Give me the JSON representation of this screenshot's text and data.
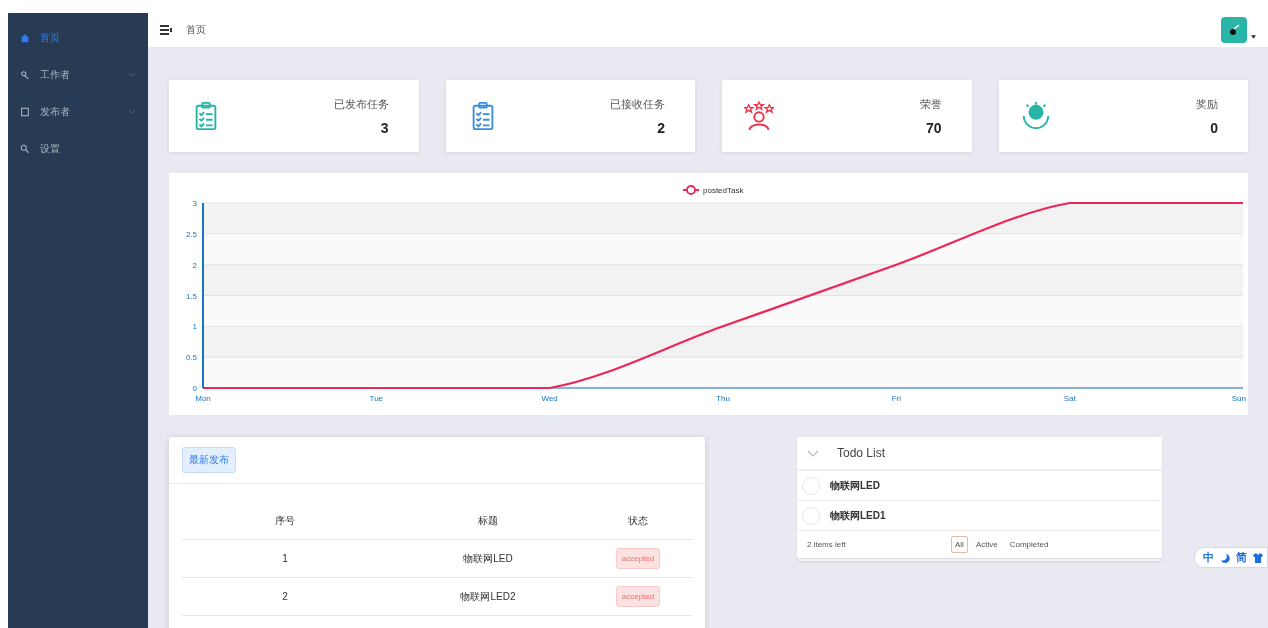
{
  "sidebar": {
    "items": [
      {
        "label": "首页",
        "selected": true,
        "expandable": false
      },
      {
        "label": "工作者",
        "selected": false,
        "expandable": true
      },
      {
        "label": "发布者",
        "selected": false,
        "expandable": true
      },
      {
        "label": "设置",
        "selected": false,
        "expandable": false
      }
    ]
  },
  "header": {
    "breadcrumb": "首页"
  },
  "stats": [
    {
      "label": "已发布任务",
      "value": "3",
      "color": "#26b5a5"
    },
    {
      "label": "已接收任务",
      "value": "2",
      "color": "#3c8de0"
    },
    {
      "label": "荣誉",
      "value": "70",
      "color": "#e8354a"
    },
    {
      "label": "奖励",
      "value": "0",
      "color": "#26b5a5"
    }
  ],
  "chart": {
    "chart_data": {
      "type": "line",
      "categories": [
        "Mon",
        "Tue",
        "Wed",
        "Thu",
        "Fri",
        "Sat",
        "Sun"
      ],
      "series": [
        {
          "name": "postedTask",
          "color": "#ec2758",
          "values": [
            0,
            0,
            0,
            1,
            2,
            3,
            3
          ]
        }
      ],
      "ylim": [
        0,
        3
      ],
      "grid": true,
      "yticks": [
        0,
        0.5,
        1,
        1.5,
        2,
        2.5,
        3
      ]
    }
  },
  "latest": {
    "button": "最新发布",
    "columns": [
      "序号",
      "标题",
      "状态"
    ],
    "rows": [
      {
        "index": "1",
        "title": "物联网LED",
        "status": "accepted",
        "color": "#fde2e2"
      },
      {
        "index": "2",
        "title": "物联网LED2",
        "status": "accepted",
        "color": "#fde2e2"
      }
    ]
  },
  "todo": {
    "title": "Todo List",
    "items": [
      {
        "text": "物联网LED",
        "checked": false
      },
      {
        "text": "物联网LED1",
        "checked": false
      }
    ],
    "left": "2 items left",
    "filters": [
      {
        "label": "All",
        "selected": true
      },
      {
        "label": "Active",
        "selected": false
      },
      {
        "label": "Completed",
        "selected": false
      }
    ]
  },
  "ime": {
    "labels": [
      "中",
      "简"
    ]
  }
}
